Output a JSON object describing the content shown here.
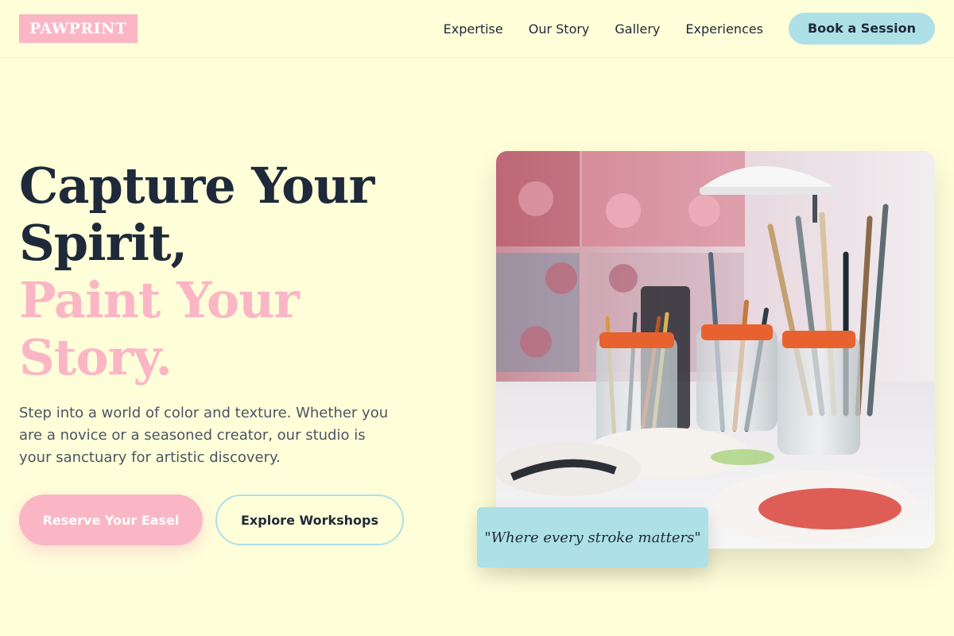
{
  "header": {
    "logo": "PAWPRINT",
    "nav": [
      "Expertise",
      "Our Story",
      "Gallery",
      "Experiences"
    ],
    "cta": "Book a Session"
  },
  "hero": {
    "headline_line1": "Capture Your",
    "headline_line2": "Spirit,",
    "headline_line3": "Paint Your",
    "headline_line4": "Story.",
    "subtext": "Step into a world of color and texture. Whether you are a novice or a seasoned creator, our studio is your sanctuary for artistic discovery.",
    "primary_button": "Reserve Your Easel",
    "secondary_button": "Explore Workshops",
    "quote": "\"Where every stroke matters\""
  },
  "colors": {
    "background": "#fefed9",
    "pink": "#fbb6c5",
    "teal": "#aee0e8",
    "dark": "#1e2a3a"
  }
}
